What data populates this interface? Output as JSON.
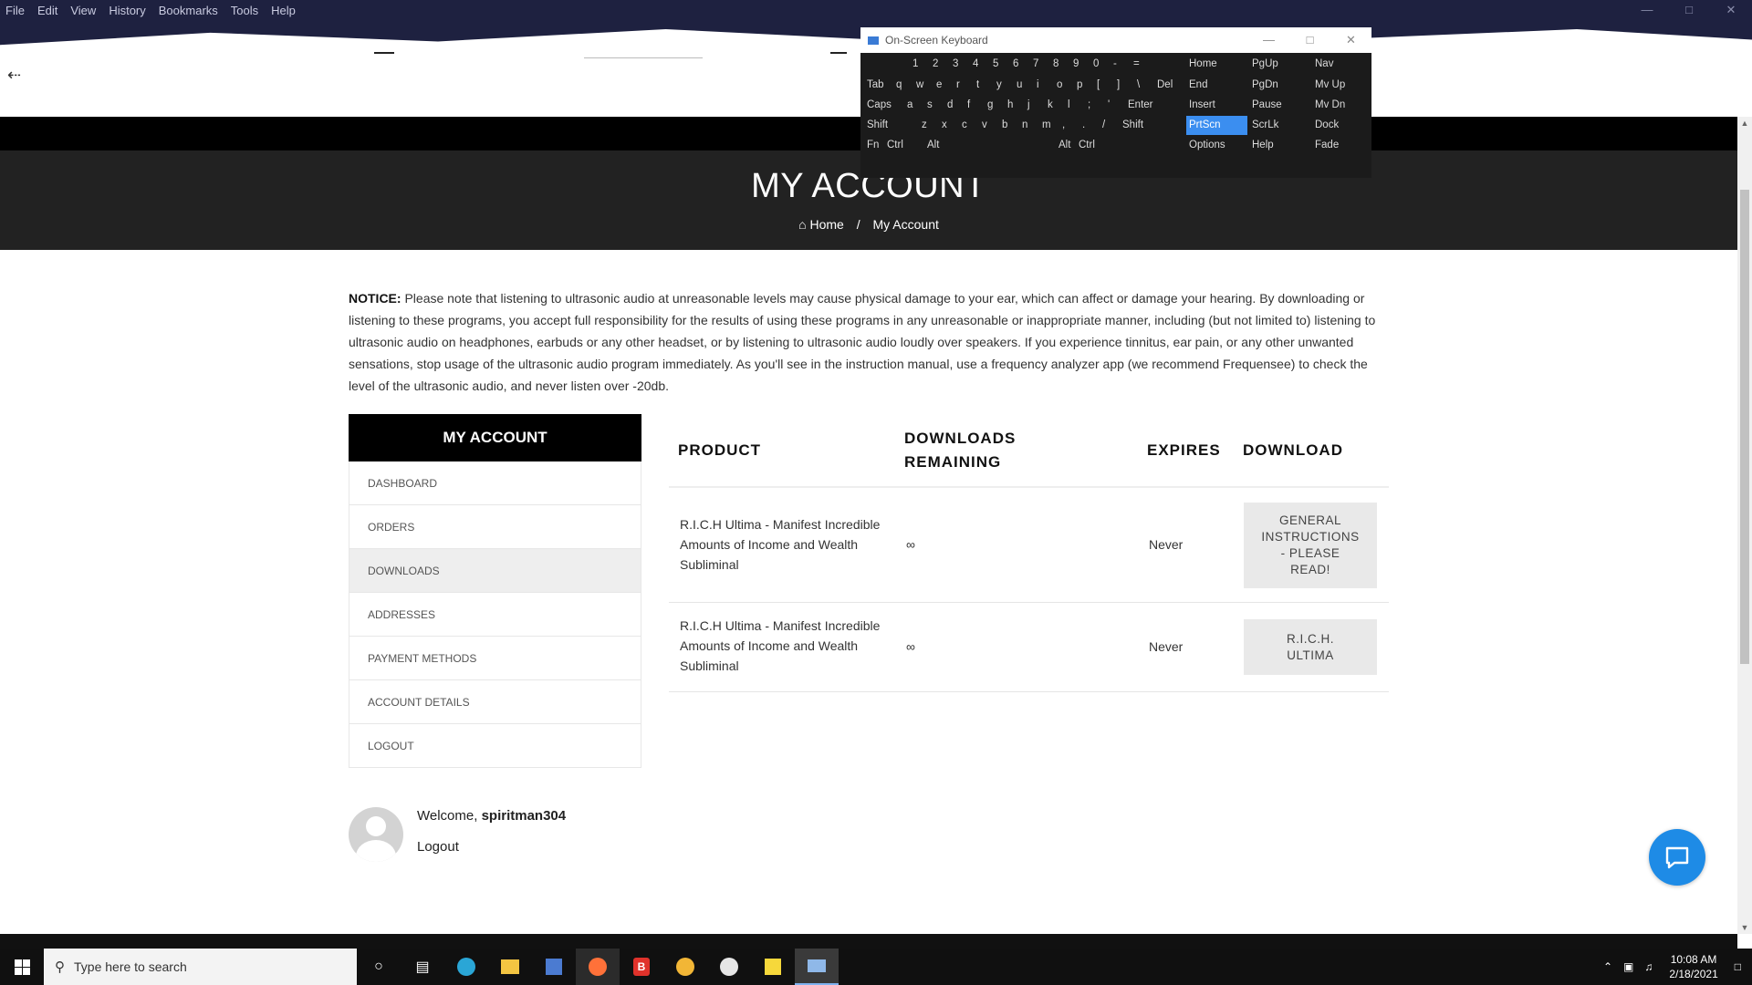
{
  "browser": {
    "menu": [
      "File",
      "Edit",
      "View",
      "History",
      "Bookmarks",
      "Tools",
      "Help"
    ]
  },
  "hero": {
    "title": "MY ACCOUNT",
    "breadcrumb_home": "Home",
    "breadcrumb_separator": "/",
    "breadcrumb_current": "My Account"
  },
  "notice": {
    "label": "NOTICE:",
    "text": "Please note that listening to ultrasonic audio at unreasonable levels may cause physical damage to your ear, which can affect or damage your hearing. By downloading or listening to these programs, you accept full responsibility for the results of using these programs in any unreasonable or inappropriate manner, including (but not limited to) listening to ultrasonic audio on headphones, earbuds or any other headset, or by listening to ultrasonic audio loudly over speakers.  If you experience tinnitus, ear pain, or any other unwanted sensations, stop usage of the ultrasonic audio program immediately. As you'll see in the instruction manual, use a frequency analyzer app (we recommend Frequensee) to check the level of the ultrasonic audio, and never listen over -20db."
  },
  "account_nav": {
    "header": "MY ACCOUNT",
    "items": [
      "DASHBOARD",
      "ORDERS",
      "DOWNLOADS",
      "ADDRESSES",
      "PAYMENT METHODS",
      "ACCOUNT DETAILS",
      "LOGOUT"
    ],
    "active": "DOWNLOADS"
  },
  "downloads": {
    "headers": {
      "product": "PRODUCT",
      "remaining_1": "DOWNLOADS",
      "remaining_2": "REMAINING",
      "expires": "EXPIRES",
      "download": "DOWNLOAD"
    },
    "rows": [
      {
        "product_1": "R.I.C.H Ultima - Manifest Incredible",
        "product_2": "Amounts of Income and Wealth",
        "product_3": "Subliminal",
        "remaining": "∞",
        "expires": "Never",
        "button_1": "GENERAL",
        "button_2": "INSTRUCTIONS",
        "button_3": "- PLEASE",
        "button_4": "READ!"
      },
      {
        "product_1": "R.I.C.H Ultima - Manifest Incredible",
        "product_2": "Amounts of Income and Wealth",
        "product_3": "Subliminal",
        "remaining": "∞",
        "expires": "Never",
        "button_1": "R.I.C.H.",
        "button_2": "ULTIMA"
      }
    ]
  },
  "welcome": {
    "prefix": "Welcome, ",
    "username": "spiritman304",
    "logout": "Logout"
  },
  "osk": {
    "title": "On-Screen Keyboard",
    "highlight_color": "#3b8ef0",
    "row1": [
      "1",
      "2",
      "3",
      "4",
      "5",
      "6",
      "7",
      "8",
      "9",
      "0",
      "-",
      "="
    ],
    "row2": [
      "Tab",
      "q",
      "w",
      "e",
      "r",
      "t",
      "y",
      "u",
      "i",
      "o",
      "p",
      "[",
      "]",
      "\\",
      "Del"
    ],
    "row3": [
      "Caps",
      "a",
      "s",
      "d",
      "f",
      "g",
      "h",
      "j",
      "k",
      "l",
      ";",
      "'",
      "Enter"
    ],
    "row4": [
      "Shift",
      "z",
      "x",
      "c",
      "v",
      "b",
      "n",
      "m",
      ",",
      ".",
      "/",
      "Shift"
    ],
    "row5": [
      "Fn",
      "Ctrl",
      "Alt",
      "Alt",
      "Ctrl"
    ],
    "nav": [
      [
        "Home",
        "PgUp",
        "Nav"
      ],
      [
        "End",
        "PgDn",
        "Mv Up"
      ],
      [
        "Insert",
        "Pause",
        "Mv Dn"
      ],
      [
        "PrtScn",
        "ScrLk",
        "Dock"
      ],
      [
        "Options",
        "Help",
        "Fade"
      ]
    ]
  },
  "taskbar": {
    "search_placeholder": "Type here to search",
    "time": "10:08 AM",
    "date": "2/18/2021"
  },
  "colors": {
    "hero_bg": "#222222",
    "nav_header_bg": "#000000",
    "chat_button": "#1e8be6",
    "browser_chrome": "#1e2140"
  }
}
